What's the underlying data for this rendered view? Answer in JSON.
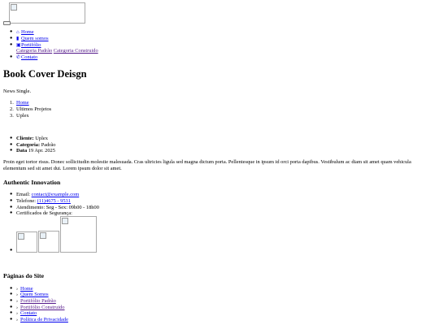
{
  "header": {
    "logo_alt": "",
    "nav": [
      {
        "label": "Home",
        "icon": "home-icon"
      },
      {
        "label": "Quem somos",
        "icon": "book-icon"
      },
      {
        "label": "Portifólio",
        "icon": "briefcase-icon"
      },
      {
        "label": "Contato",
        "icon": "phone-icon"
      }
    ],
    "submenu": [
      "Categoria Padrão",
      "Categoria Construido"
    ]
  },
  "page": {
    "title": "Book Cover Deisgn",
    "subtitle": "News Single.",
    "breadcrumb": [
      "Home",
      "Ultimos Projetos",
      "Uplex"
    ],
    "details": [
      {
        "label": "Cliente:",
        "value": "Uplex"
      },
      {
        "label": "Categoria:",
        "value": "Padrão"
      },
      {
        "label": "Data",
        "value": "19 Apr. 2025"
      }
    ],
    "body_line1": "Proin eget tortor risus. Donec sollicitudin molestie malesuada. Cras ultricies ligula sed magna dictum porta. Pellentesque in ipsum id orci porta dapibus. Vestibulum ac diam sit amet quam vehicula",
    "body_line2": "elementum sed sit amet dui. Lorem ipsum dolor sit amet."
  },
  "footer": {
    "company_title": "Authentic Innovation",
    "email_label": "Email: ",
    "email": "contact@example.com",
    "phone_label": "Telefone: ",
    "phone": "(11)4675 - 9531",
    "hours": "Atendimento: Seg - Sex: 09h00 - 18h00",
    "certs": "Certificados de Segurança:",
    "pages_title": "Páginas do Site",
    "pages": [
      "Home",
      "Quem Somos",
      "Portifólio Padrão",
      "Portifólio Construido",
      "Contato",
      "Política de Privacidade"
    ]
  }
}
